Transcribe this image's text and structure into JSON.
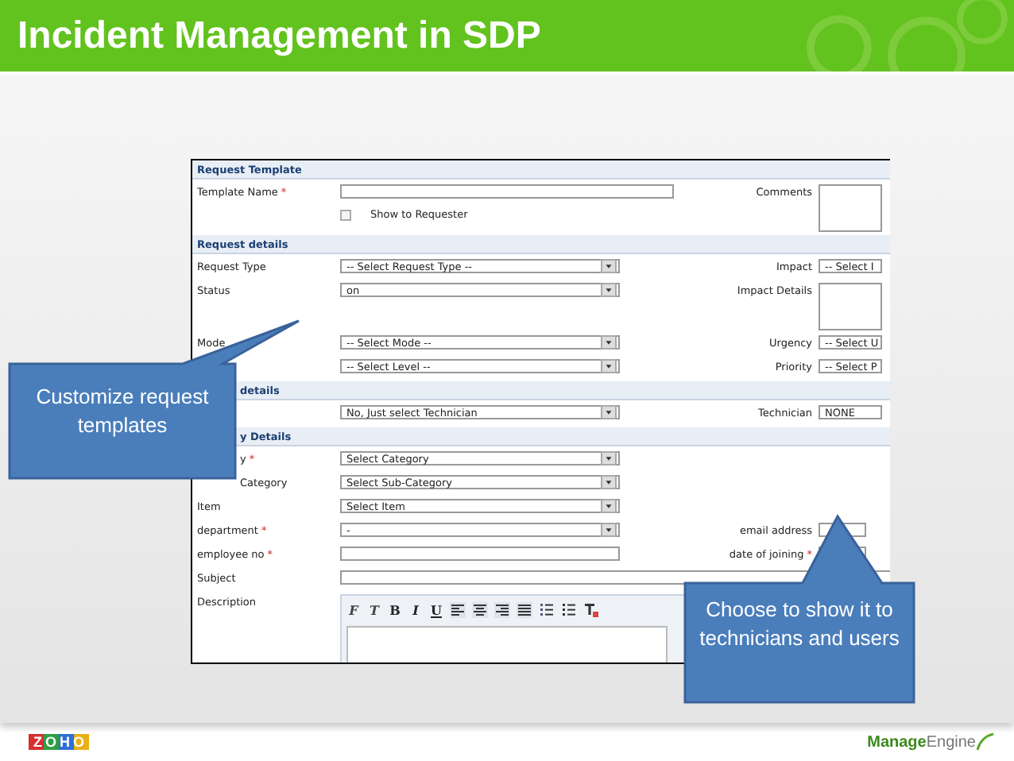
{
  "title": "Incident Management in SDP",
  "form": {
    "sections": [
      {
        "title": "Request Template",
        "rows": [
          {
            "label": "Template Name",
            "mark": "*",
            "field": {
              "kind": "input-wide"
            },
            "checkbox": {
              "label": "Show to Requester",
              "checked": false
            },
            "right": {
              "label": "Comments",
              "field": {
                "kind": "textarea"
              }
            }
          }
        ]
      },
      {
        "title": "Request details",
        "rows": [
          {
            "label": "Request Type",
            "field": {
              "kind": "select",
              "value": "-- Select Request Type --"
            },
            "right": {
              "label": "Impact",
              "field": {
                "kind": "select",
                "value": "-- Select I"
              }
            }
          },
          {
            "label": "Status",
            "field": {
              "kind": "select",
              "value": "on"
            },
            "right": {
              "label": "Impact Details",
              "field": {
                "kind": "textarea"
              }
            }
          },
          {
            "label": "Mode",
            "field": {
              "kind": "select",
              "value": "-- Select Mode --"
            },
            "right": {
              "label": "Urgency",
              "field": {
                "kind": "select",
                "value": "-- Select U"
              }
            }
          },
          {
            "field": {
              "kind": "select",
              "value": "-- Select Level --"
            },
            "right": {
              "label": "Priority",
              "field": {
                "kind": "select",
                "value": "-- Select P"
              }
            }
          }
        ]
      },
      {
        "title": "details",
        "covered": true,
        "rows": [
          {
            "field": {
              "kind": "select",
              "value": "No, Just select Technician"
            },
            "right": {
              "label": "Technician",
              "field": {
                "kind": "select",
                "value": "NONE"
              }
            }
          }
        ]
      },
      {
        "title": "y Details",
        "covered": true,
        "rows": [
          {
            "label": "y",
            "mark": "*",
            "covered": true,
            "field": {
              "kind": "select",
              "value": "Select Category"
            }
          },
          {
            "label": "Category",
            "covered": true,
            "field": {
              "kind": "select",
              "value": "Select Sub-Category"
            }
          },
          {
            "label": "Item",
            "field": {
              "kind": "select",
              "value": "Select Item"
            }
          },
          {
            "label": "department",
            "mark": "*",
            "field": {
              "kind": "select",
              "value": "-"
            },
            "right": {
              "label": "email address",
              "field": {
                "kind": "input"
              }
            }
          },
          {
            "label": "employee no",
            "mark": "*",
            "field": {
              "kind": "input"
            },
            "right": {
              "label": "date of joining",
              "mark": "*",
              "field": {
                "kind": "input"
              }
            }
          },
          {
            "label": "Subject",
            "field": {
              "kind": "input-full"
            }
          },
          {
            "label": "Description",
            "field": {
              "kind": "editor",
              "toolbar": [
                {
                  "kind": "text",
                  "label": "F"
                },
                {
                  "kind": "text",
                  "label": "T"
                },
                {
                  "kind": "text",
                  "label": "B"
                },
                {
                  "kind": "text",
                  "label": "I"
                },
                {
                  "kind": "text",
                  "label": "U"
                },
                {
                  "kind": "align-left"
                },
                {
                  "kind": "align-center"
                },
                {
                  "kind": "align-right"
                },
                {
                  "kind": "justify"
                },
                {
                  "kind": "ordered-list"
                },
                {
                  "kind": "bullet-list"
                },
                {
                  "kind": "text-color"
                }
              ]
            }
          }
        ]
      }
    ]
  },
  "callouts": [
    {
      "text": "Customize request templates"
    },
    {
      "text": "Choose to show it to technicians and users"
    }
  ],
  "footer": {
    "left_logo": "ZOHO",
    "right_logo": "**Manage**Engine"
  }
}
